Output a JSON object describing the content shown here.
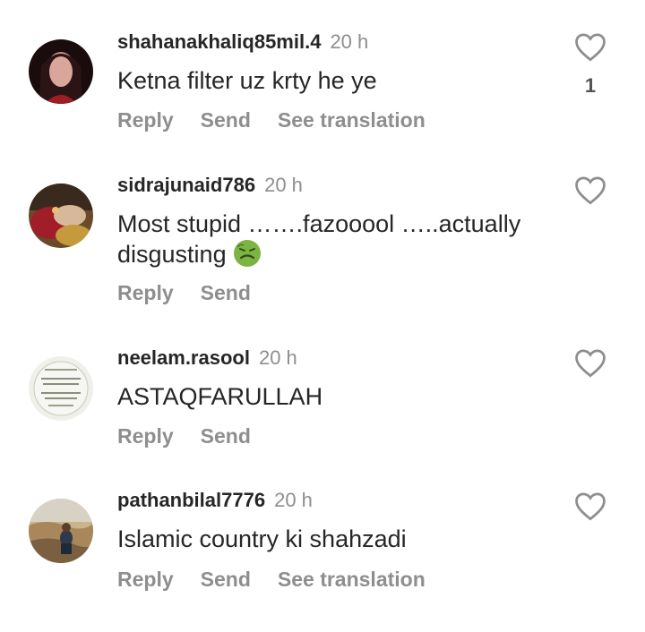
{
  "comments": [
    {
      "username": "shahanakhaliq85mil.4",
      "time": "20 h",
      "text": "Ketna filter uz krty he ye",
      "actions": [
        "Reply",
        "Send",
        "See translation"
      ],
      "likes": "1"
    },
    {
      "username": "sidrajunaid786",
      "time": "20 h",
      "text": "Most stupid …….fazooool …..actually disgusting",
      "emoji": "nauseated-face-emoji",
      "actions": [
        "Reply",
        "Send"
      ]
    },
    {
      "username": "neelam.rasool",
      "time": "20 h",
      "text": "ASTAQFARULLAH",
      "actions": [
        "Reply",
        "Send"
      ]
    },
    {
      "username": "pathanbilal7776",
      "time": "20 h",
      "text": "Islamic country ki shahzadi",
      "actions": [
        "Reply",
        "Send",
        "See translation"
      ]
    }
  ],
  "icons": {
    "like": "heart-outline-icon"
  }
}
